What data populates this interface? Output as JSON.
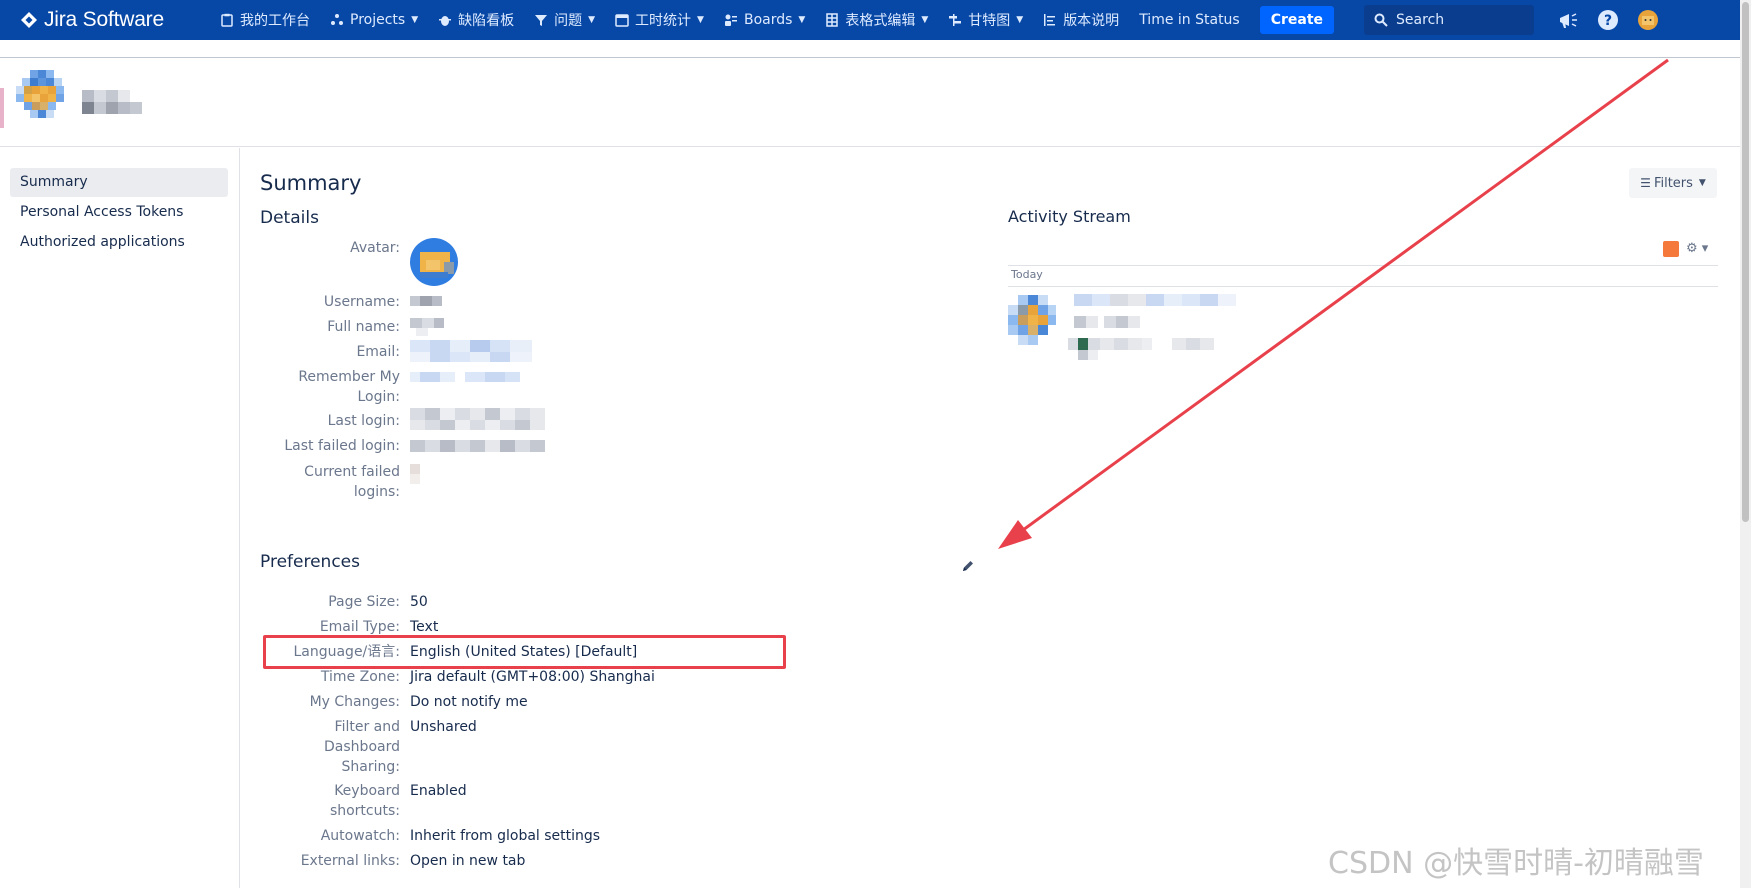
{
  "nav": {
    "brand": "Jira Software",
    "items": [
      {
        "label": "我的工作台",
        "icon": "clipboard-icon",
        "dropdown": false
      },
      {
        "label": "Projects",
        "icon": "projects-icon",
        "dropdown": true
      },
      {
        "label": "缺陷看板",
        "icon": "bug-icon",
        "dropdown": false
      },
      {
        "label": "问题",
        "icon": "filter-icon",
        "dropdown": true
      },
      {
        "label": "工时统计",
        "icon": "calendar-icon",
        "dropdown": true
      },
      {
        "label": "Boards",
        "icon": "boards-icon",
        "dropdown": true
      },
      {
        "label": "表格式编辑",
        "icon": "table-icon",
        "dropdown": true
      },
      {
        "label": "甘特图",
        "icon": "gantt-icon",
        "dropdown": true
      },
      {
        "label": "版本说明",
        "icon": "release-notes-icon",
        "dropdown": false
      },
      {
        "label": "Time in Status",
        "icon": "",
        "dropdown": false
      }
    ],
    "create_label": "Create",
    "search_placeholder": "Search"
  },
  "sidebar": {
    "items": [
      {
        "label": "Summary",
        "active": true
      },
      {
        "label": "Personal Access Tokens",
        "active": false
      },
      {
        "label": "Authorized applications",
        "active": false
      }
    ]
  },
  "main": {
    "title": "Summary",
    "filters_label": "Filters",
    "details": {
      "title": "Details",
      "labels": {
        "avatar": "Avatar:",
        "username": "Username:",
        "fullname": "Full name:",
        "email": "Email:",
        "remember_login_l1": "Remember My",
        "remember_login_l2": "Login:",
        "last_login": "Last login:",
        "last_failed_login": "Last failed login:",
        "current_failed_l1": "Current failed",
        "current_failed_l2": "logins:"
      }
    },
    "preferences": {
      "title": "Preferences",
      "rows": [
        {
          "label": "Page Size:",
          "value": "50"
        },
        {
          "label": "Email Type:",
          "value": "Text"
        },
        {
          "label": "Language/语言:",
          "value": "English (United States) [Default]"
        },
        {
          "label": "Time Zone:",
          "value": "Jira default (GMT+08:00) Shanghai"
        },
        {
          "label": "My Changes:",
          "value": "Do not notify me"
        },
        {
          "label_lines": [
            "Filter and",
            "Dashboard",
            "Sharing:"
          ],
          "value": "Unshared"
        },
        {
          "label_lines": [
            "Keyboard",
            "shortcuts:"
          ],
          "value": "Enabled"
        },
        {
          "label": "Autowatch:",
          "value": "Inherit from global settings"
        },
        {
          "label": "External links:",
          "value": "Open in new tab"
        }
      ]
    }
  },
  "activity": {
    "title": "Activity Stream",
    "today_label": "Today"
  },
  "watermark": "CSDN @快雪时晴-初晴融雪",
  "colors": {
    "nav_bg": "#0747a6",
    "create_btn": "#0065ff",
    "highlight": "#e8414b"
  }
}
